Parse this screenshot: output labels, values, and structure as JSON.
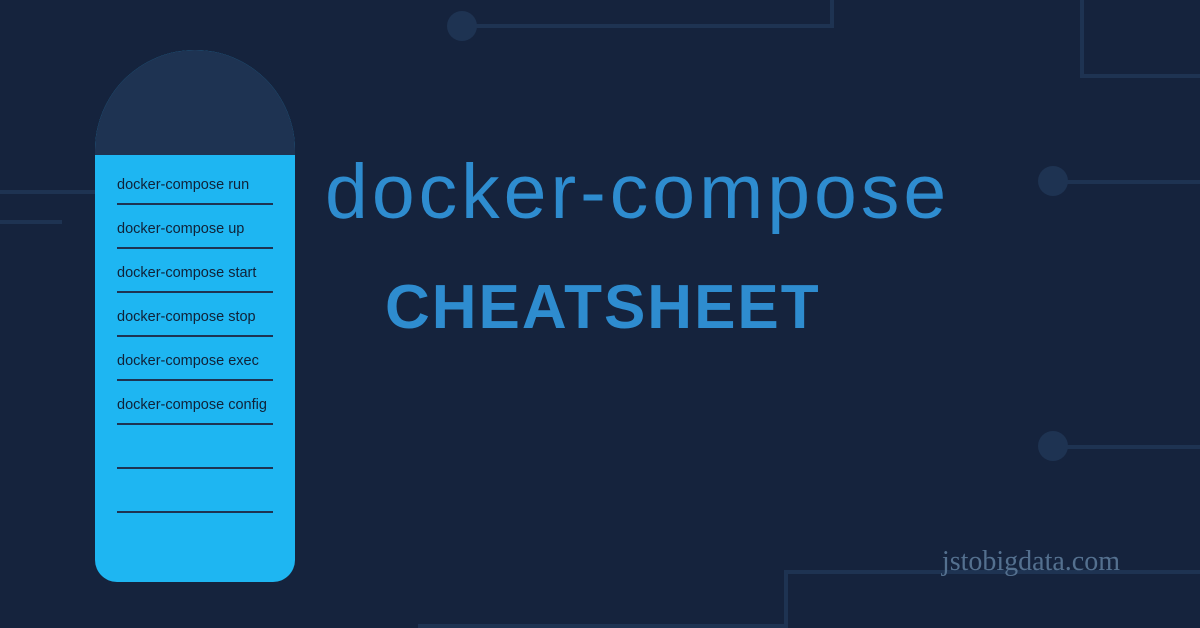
{
  "headline": "docker-compose",
  "subhead": "CHEATSHEET",
  "attribution": "jstobigdata.com",
  "notepad": {
    "lines": [
      "docker-compose run",
      "docker-compose up",
      "docker-compose start",
      "docker-compose stop",
      "docker-compose exec",
      "docker-compose config",
      "",
      ""
    ]
  }
}
